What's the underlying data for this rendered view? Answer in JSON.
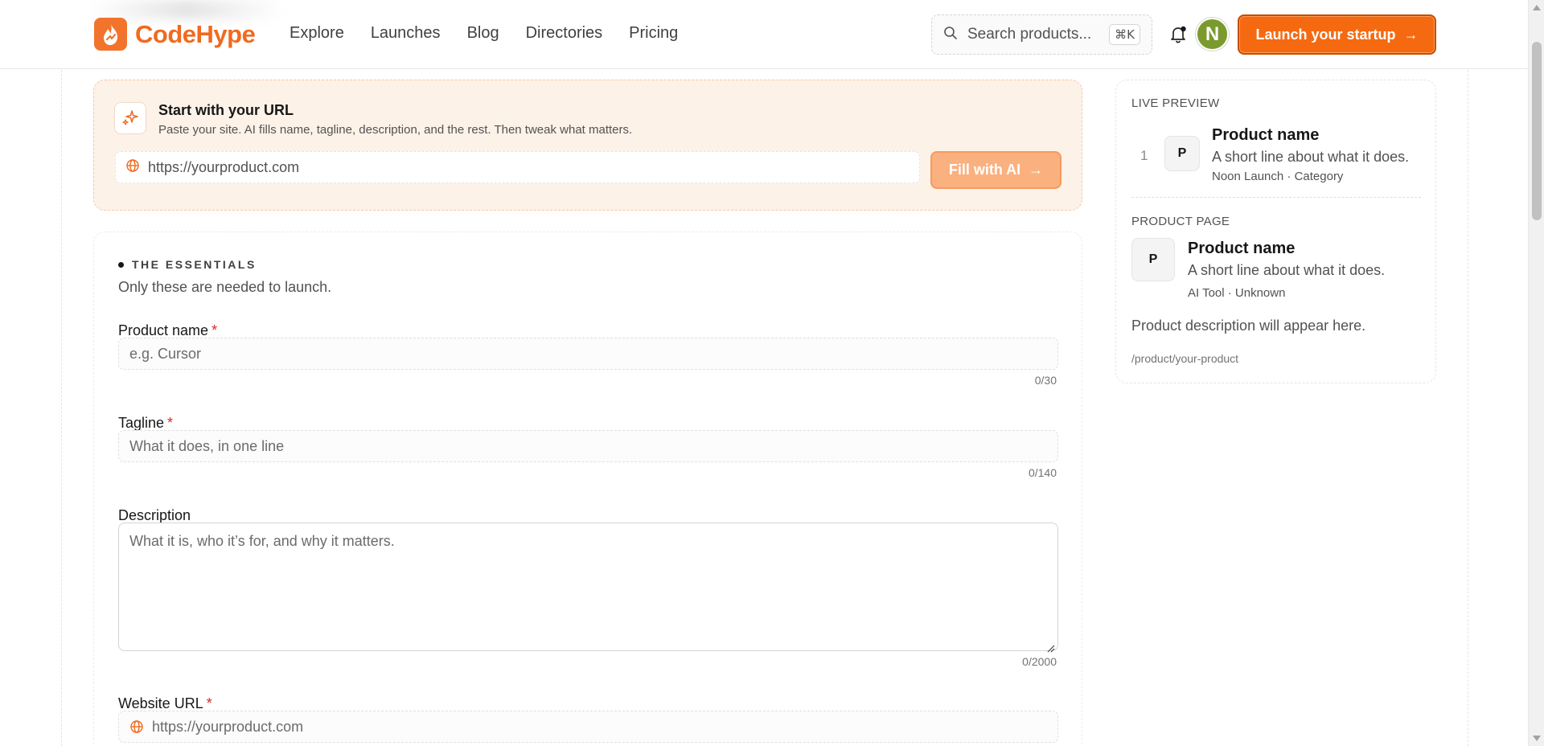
{
  "header": {
    "brand": "CodeHype",
    "nav": [
      "Explore",
      "Launches",
      "Blog",
      "Directories",
      "Pricing"
    ],
    "search_placeholder": "Search products...",
    "search_shortcut": "⌘K",
    "avatar_initial": "N",
    "launch_label": "Launch your startup",
    "launch_arrow": "→"
  },
  "url_card": {
    "title": "Start with your URL",
    "subtitle": "Paste your site. AI fills name, tagline, description, and the rest. Then tweak what matters.",
    "input_placeholder": "https://yourproduct.com",
    "fill_label": "Fill with AI",
    "fill_arrow": "→"
  },
  "essentials": {
    "title": "THE ESSENTIALS",
    "subtitle": "Only these are needed to launch.",
    "required_mark": "*",
    "fields": {
      "product_name": {
        "label": "Product name",
        "placeholder": "e.g. Cursor",
        "counter": "0/30"
      },
      "tagline": {
        "label": "Tagline",
        "placeholder": "What it does, in one line",
        "counter": "0/140"
      },
      "description": {
        "label": "Description",
        "placeholder": "What it is, who it’s for, and why it matters.",
        "counter": "0/2000"
      },
      "website_url": {
        "label": "Website URL",
        "placeholder": "https://yourproduct.com"
      }
    }
  },
  "preview": {
    "live_label": "LIVE PREVIEW",
    "rank": "1",
    "thumb_initial": "P",
    "name": "Product name",
    "tagline": "A short line about what it does.",
    "live_meta": "Noon Launch · Category",
    "page_label": "PRODUCT PAGE",
    "page_meta": "AI Tool · Unknown",
    "description": "Product description will appear here.",
    "slug": "/product/your-product"
  },
  "colors": {
    "accent": "#f56a10",
    "accent_light": "#fbb07f",
    "url_card_bg": "#fdf2e8",
    "required": "#dc2626",
    "avatar_bg": "#7a9a2e"
  },
  "icons": [
    "flame-logo-icon",
    "search-icon",
    "bell-icon",
    "sparkles-icon",
    "globe-icon",
    "arrow-right-icon",
    "resize-handle-icon"
  ]
}
